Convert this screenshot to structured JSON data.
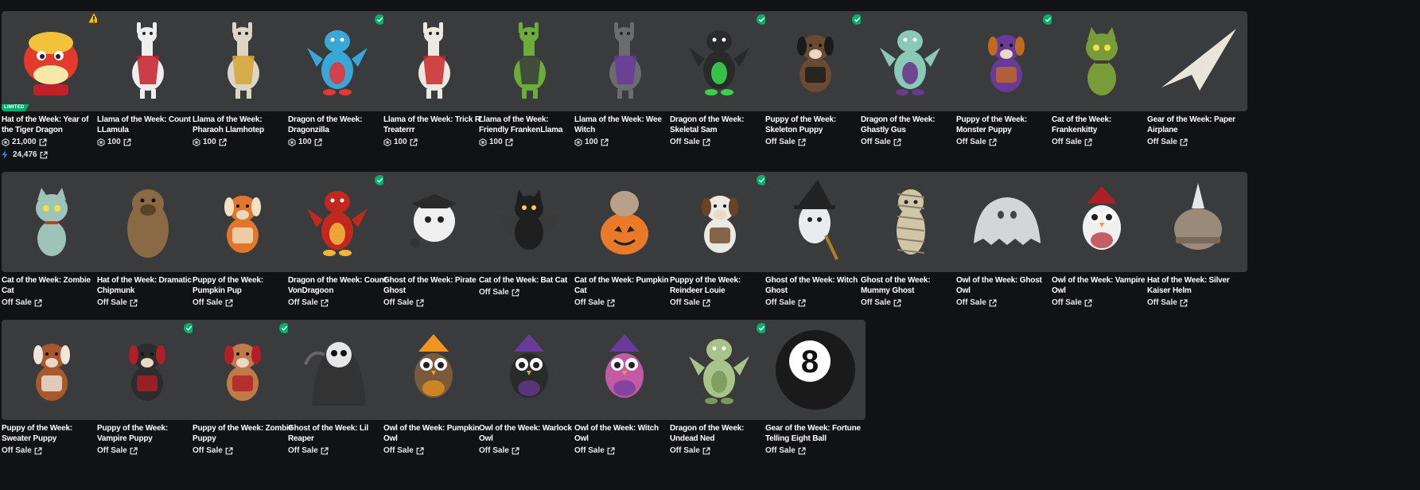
{
  "items": [
    {
      "name": "Hat of the Week: Year of the Tiger Dragon",
      "price": "21,000",
      "currency": "robux",
      "secondary_price": "24,476",
      "badge": "LIMITED",
      "status": "warning",
      "art": {
        "kind": "lion",
        "body": "#e23b2e",
        "accent": "#f2c23b"
      }
    },
    {
      "name": "Llama of the Week: Count LLamula",
      "price": "100",
      "currency": "robux",
      "status": "none",
      "art": {
        "kind": "llama",
        "body": "#eeeeee",
        "accent": "#c41f2a"
      }
    },
    {
      "name": "Llama of the Week: Pharaoh Llamhotep",
      "price": "100",
      "currency": "robux",
      "status": "none",
      "art": {
        "kind": "llama",
        "body": "#ddd6c6",
        "accent": "#d6a636"
      }
    },
    {
      "name": "Dragon of the Week: Dragonzilla",
      "price": "100",
      "currency": "robux",
      "status": "owned",
      "art": {
        "kind": "dragon",
        "body": "#3aa7d9",
        "accent": "#e2383a"
      }
    },
    {
      "name": "Llama of the Week: Trick R' Treaterrr",
      "price": "100",
      "currency": "robux",
      "status": "none",
      "art": {
        "kind": "llama",
        "body": "#ece8e2",
        "accent": "#c82828"
      }
    },
    {
      "name": "Llama of the Week: Friendly FrankenLlama",
      "price": "100",
      "currency": "robux",
      "status": "none",
      "art": {
        "kind": "llama",
        "body": "#6dab3b",
        "accent": "#3b3b3b"
      }
    },
    {
      "name": "Llama of the Week: Wee Witch",
      "price": "100",
      "currency": "robux",
      "status": "none",
      "art": {
        "kind": "llama",
        "body": "#6b6b70",
        "accent": "#6a3a9a"
      }
    },
    {
      "name": "Dragon of the Week: Skeletal Sam",
      "price": "Off Sale",
      "currency": "none",
      "status": "owned",
      "art": {
        "kind": "dragon",
        "body": "#2a2a2a",
        "accent": "#37d24a"
      }
    },
    {
      "name": "Puppy of the Week: Skeleton Puppy",
      "price": "Off Sale",
      "currency": "none",
      "status": "owned",
      "art": {
        "kind": "dog",
        "body": "#6a4a32",
        "accent": "#1a1a1a"
      }
    },
    {
      "name": "Dragon of the Week: Ghastly Gus",
      "price": "Off Sale",
      "currency": "none",
      "status": "none",
      "art": {
        "kind": "dragon",
        "body": "#8bc9b7",
        "accent": "#6a3a8a"
      }
    },
    {
      "name": "Puppy of the Week: Monster Puppy",
      "price": "Off Sale",
      "currency": "none",
      "status": "owned",
      "art": {
        "kind": "dog",
        "body": "#6a3a9a",
        "accent": "#c06a20"
      }
    },
    {
      "name": "Cat of the Week: Frankenkitty",
      "price": "Off Sale",
      "currency": "none",
      "status": "none",
      "art": {
        "kind": "cat",
        "body": "#7a9b3a",
        "accent": "#3b3b3b"
      }
    },
    {
      "name": "Gear of the Week: Paper Airplane",
      "price": "Off Sale",
      "currency": "none",
      "status": "none",
      "art": {
        "kind": "plane",
        "body": "#e9e5da",
        "accent": "#bdb8aa"
      }
    },
    {
      "name": "Cat of the Week: Zombie Cat",
      "price": "Off Sale",
      "currency": "none",
      "status": "none",
      "art": {
        "kind": "cat",
        "body": "#9ec4b7",
        "accent": "#c83a2a"
      }
    },
    {
      "name": "Hat of the Week: Dramatic Chipmunk",
      "price": "Off Sale",
      "currency": "none",
      "status": "none",
      "art": {
        "kind": "chipmunk",
        "body": "#8a6a44",
        "accent": "#5a4226"
      }
    },
    {
      "name": "Puppy of the Week: Pumpkin Pup",
      "price": "Off Sale",
      "currency": "none",
      "status": "none",
      "art": {
        "kind": "dog",
        "body": "#e0772a",
        "accent": "#f1e2c5"
      }
    },
    {
      "name": "Dragon of the Week: Count VonDragoon",
      "price": "Off Sale",
      "currency": "none",
      "status": "owned",
      "art": {
        "kind": "dragon",
        "body": "#c3281f",
        "accent": "#f2b33b"
      }
    },
    {
      "name": "Ghost of the Week: Pirate Ghost",
      "price": "Off Sale",
      "currency": "none",
      "status": "none",
      "art": {
        "kind": "ghostball",
        "body": "#f0f0f0",
        "accent": "#2a2a2a"
      }
    },
    {
      "name": "Cat of the Week: Bat Cat",
      "price": "Off Sale",
      "currency": "none",
      "status": "none",
      "art": {
        "kind": "batcat",
        "body": "#1e1e1e",
        "accent": "#3a3a3a"
      }
    },
    {
      "name": "Cat of the Week: Pumpkin Cat",
      "price": "Off Sale",
      "currency": "none",
      "status": "none",
      "art": {
        "kind": "pumpkincat",
        "body": "#e87a2a",
        "accent": "#b8a08a"
      }
    },
    {
      "name": "Puppy of the Week: Reindeer Louie",
      "price": "Off Sale",
      "currency": "none",
      "status": "owned",
      "art": {
        "kind": "dog",
        "body": "#ece8e2",
        "accent": "#6a4226"
      }
    },
    {
      "name": "Ghost of the Week: Witch Ghost",
      "price": "Off Sale",
      "currency": "none",
      "status": "none",
      "art": {
        "kind": "witchghost",
        "body": "#e8ecef",
        "accent": "#222222"
      }
    },
    {
      "name": "Ghost of the Week: Mummy Ghost",
      "price": "Off Sale",
      "currency": "none",
      "status": "none",
      "art": {
        "kind": "mummy",
        "body": "#cfc6a8",
        "accent": "#8a7f64"
      }
    },
    {
      "name": "Owl of the Week: Ghost Owl",
      "price": "Off Sale",
      "currency": "none",
      "status": "none",
      "art": {
        "kind": "sheet",
        "body": "#d3d6d6",
        "accent": "#444444"
      }
    },
    {
      "name": "Owl of the Week: Vampire Owl",
      "price": "Off Sale",
      "currency": "none",
      "status": "none",
      "art": {
        "kind": "owl",
        "body": "#f0f0f0",
        "accent": "#b01e28"
      }
    },
    {
      "name": "Hat of the Week: Silver Kaiser Helm",
      "price": "Off Sale",
      "currency": "none",
      "status": "none",
      "art": {
        "kind": "helm",
        "body": "#9a8a7a",
        "accent": "#e6e6e6"
      }
    },
    {
      "name": "Puppy of the Week: Sweater Puppy",
      "price": "Off Sale",
      "currency": "none",
      "status": "none",
      "art": {
        "kind": "dog",
        "body": "#a8582a",
        "accent": "#efe6de"
      }
    },
    {
      "name": "Puppy of the Week: Vampire Puppy",
      "price": "Off Sale",
      "currency": "none",
      "status": "owned",
      "art": {
        "kind": "dog",
        "body": "#2c2c2c",
        "accent": "#b01e28"
      }
    },
    {
      "name": "Puppy of the Week: Zombie Puppy",
      "price": "Off Sale",
      "currency": "none",
      "status": "owned",
      "art": {
        "kind": "dog",
        "body": "#c07a4a",
        "accent": "#b01e28"
      }
    },
    {
      "name": "Ghost of the Week: Lil Reaper",
      "price": "Off Sale",
      "currency": "none",
      "status": "none",
      "art": {
        "kind": "reaper",
        "body": "#333333",
        "accent": "#e6e6e6"
      }
    },
    {
      "name": "Owl of the Week: Pumpkin Owl",
      "price": "Off Sale",
      "currency": "none",
      "status": "none",
      "art": {
        "kind": "owl",
        "body": "#7a5a3a",
        "accent": "#f0951f"
      }
    },
    {
      "name": "Owl of the Week: Warlock Owl",
      "price": "Off Sale",
      "currency": "none",
      "status": "none",
      "art": {
        "kind": "owl",
        "body": "#2a2a2a",
        "accent": "#6a3a9a"
      }
    },
    {
      "name": "Owl of the Week: Witch Owl",
      "price": "Off Sale",
      "currency": "none",
      "status": "none",
      "art": {
        "kind": "owl",
        "body": "#c25aa6",
        "accent": "#6a3a9a"
      }
    },
    {
      "name": "Dragon of the Week: Undead Ned",
      "price": "Off Sale",
      "currency": "none",
      "status": "owned",
      "art": {
        "kind": "dragon",
        "body": "#a9c48a",
        "accent": "#7b9a5a"
      }
    },
    {
      "name": "Gear of the Week: Fortune Telling Eight Ball",
      "price": "Off Sale",
      "currency": "none",
      "status": "none",
      "art": {
        "kind": "eightball",
        "body": "#1a1a1a",
        "accent": "#ffffff"
      }
    }
  ],
  "colors": {
    "page_bg": "#111214",
    "card_bg": "#393b3d",
    "owned_check": "#00b06f",
    "limited_badge": "#00b06f",
    "warning": "#f2c500",
    "bolt": "#2b7de9"
  },
  "icons": {
    "robux": "robux-icon",
    "external": "external-link-icon",
    "owned": "checkmark-icon",
    "warning": "warning-icon",
    "secondary": "lightning-icon"
  }
}
